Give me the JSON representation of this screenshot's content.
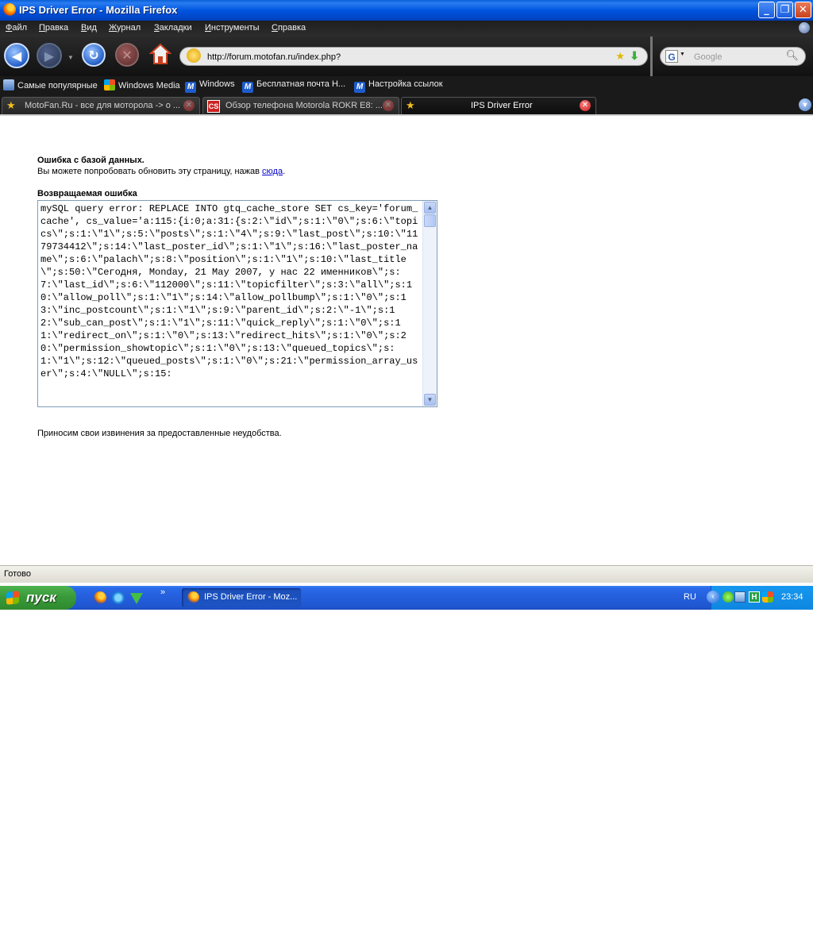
{
  "window": {
    "title": "IPS Driver Error - Mozilla Firefox",
    "controls": [
      "minimize",
      "maximize",
      "close"
    ]
  },
  "menu": {
    "items": [
      "Файл",
      "Правка",
      "Вид",
      "Журнал",
      "Закладки",
      "Инструменты",
      "Справка"
    ]
  },
  "navigation": {
    "url": "http://forum.motofan.ru/index.php?",
    "search_placeholder": "Google",
    "search_engine_icon": "G"
  },
  "bookmarks": {
    "items": [
      {
        "label": "Самые популярные",
        "icon": "most-visited-icon"
      },
      {
        "label": "Windows Media",
        "icon": "windows-icon"
      },
      {
        "label": "Windows",
        "icon": "msn-icon"
      },
      {
        "label": "Бесплатная почта H...",
        "icon": "msn-icon"
      },
      {
        "label": "Настройка ссылок",
        "icon": "msn-icon"
      }
    ]
  },
  "tabs": [
    {
      "label": "MotoFan.Ru - все для моторола -> о ...",
      "active": false,
      "icon": "star-icon"
    },
    {
      "label": "Обзор телефона Motorola ROKR E8: ...",
      "active": false,
      "icon": "cs-icon",
      "icon_text": "CS"
    },
    {
      "label": "IPS Driver Error",
      "active": true,
      "icon": "star-icon"
    }
  ],
  "page": {
    "error_title": "Ошибка с базой данных.",
    "error_msg_before": "Вы можете попробовать обновить эту страницу, нажав ",
    "error_msg_link": "сюда",
    "error_msg_after": ".",
    "returned_error_title": "Возвращаемая ошибка",
    "error_text": "mySQL query error: REPLACE INTO gtq_cache_store SET cs_key='forum_cache', cs_value='a:115:{i:0;a:31:{s:2:\\\"id\\\";s:1:\\\"0\\\";s:6:\\\"topics\\\";s:1:\\\"1\\\";s:5:\\\"posts\\\";s:1:\\\"4\\\";s:9:\\\"last_post\\\";s:10:\\\"1179734412\\\";s:14:\\\"last_poster_id\\\";s:1:\\\"1\\\";s:16:\\\"last_poster_name\\\";s:6:\\\"palach\\\";s:8:\\\"position\\\";s:1:\\\"1\\\";s:10:\\\"last_title\\\";s:50:\\\"Сегодня, Monday, 21 May 2007, у нас 22 именников\\\";s:7:\\\"last_id\\\";s:6:\\\"112000\\\";s:11:\\\"topicfilter\\\";s:3:\\\"all\\\";s:10:\\\"allow_poll\\\";s:1:\\\"1\\\";s:14:\\\"allow_pollbump\\\";s:1:\\\"0\\\";s:13:\\\"inc_postcount\\\";s:1:\\\"1\\\";s:9:\\\"parent_id\\\";s:2:\\\"-1\\\";s:12:\\\"sub_can_post\\\";s:1:\\\"1\\\";s:11:\\\"quick_reply\\\";s:1:\\\"0\\\";s:11:\\\"redirect_on\\\";s:1:\\\"0\\\";s:13:\\\"redirect_hits\\\";s:1:\\\"0\\\";s:20:\\\"permission_showtopic\\\";s:1:\\\"0\\\";s:13:\\\"queued_topics\\\";s:1:\\\"1\\\";s:12:\\\"queued_posts\\\";s:1:\\\"0\\\";s:21:\\\"permission_array_user\\\";s:4:\\\"NULL\\\";s:15:",
    "apology": "Приносим свои извинения за предоставленные неудобства."
  },
  "status": {
    "text": "Готово"
  },
  "taskbar": {
    "start_label": "пуск",
    "quick_launch_more": "»",
    "task_label": "IPS Driver Error - Moz...",
    "language": "RU",
    "clock": "23:34"
  },
  "colors": {
    "titlebar": "#0055e0",
    "toolbar": "#1a1a1a",
    "link": "#0000cc",
    "taskbar": "#245edb",
    "start_button": "#3a9a3a"
  }
}
